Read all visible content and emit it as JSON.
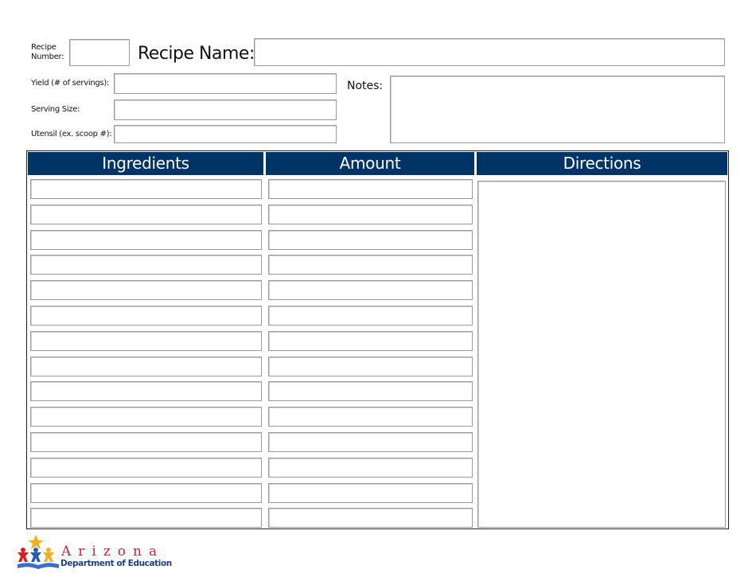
{
  "header": {
    "recipe_number_label": "Recipe Number:",
    "recipe_name_label": "Recipe Name:",
    "yield_label": "Yield (# of servings):",
    "serving_size_label": "Serving Size:",
    "utensil_label": "Utensil (ex. scoop #):",
    "notes_label": "Notes:"
  },
  "fields": {
    "recipe_number": "",
    "recipe_name": "",
    "yield": "",
    "serving_size": "",
    "utensil": "",
    "notes": "",
    "directions": ""
  },
  "table": {
    "columns": [
      "Ingredients",
      "Amount",
      "Directions"
    ],
    "header_color": "#003366",
    "rows": [
      {
        "ingredient": "",
        "amount": ""
      },
      {
        "ingredient": "",
        "amount": ""
      },
      {
        "ingredient": "",
        "amount": ""
      },
      {
        "ingredient": "",
        "amount": ""
      },
      {
        "ingredient": "",
        "amount": ""
      },
      {
        "ingredient": "",
        "amount": ""
      },
      {
        "ingredient": "",
        "amount": ""
      },
      {
        "ingredient": "",
        "amount": ""
      },
      {
        "ingredient": "",
        "amount": ""
      },
      {
        "ingredient": "",
        "amount": ""
      },
      {
        "ingredient": "",
        "amount": ""
      },
      {
        "ingredient": "",
        "amount": ""
      },
      {
        "ingredient": "",
        "amount": ""
      },
      {
        "ingredient": "",
        "amount": ""
      }
    ]
  },
  "logo": {
    "line1": "Arizona",
    "line2": "Department of Education"
  }
}
